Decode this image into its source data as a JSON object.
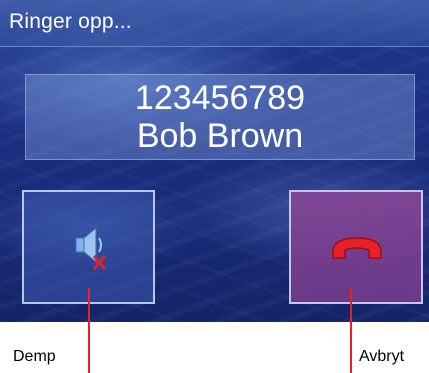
{
  "title_bar": {
    "status_text": "Ringer opp..."
  },
  "call_info": {
    "number": "123456789",
    "name": "Bob Brown"
  },
  "buttons": {
    "mute": {
      "icon": "speaker-muted-icon"
    },
    "hang_up": {
      "icon": "phone-hangup-icon"
    }
  },
  "annotations": {
    "mute_label": "Demp",
    "hang_up_label": "Avbryt"
  },
  "colors": {
    "accent_red": "#e8202a",
    "hangup_bg": "#8a4596",
    "screen_bg": "#1b2f82"
  }
}
